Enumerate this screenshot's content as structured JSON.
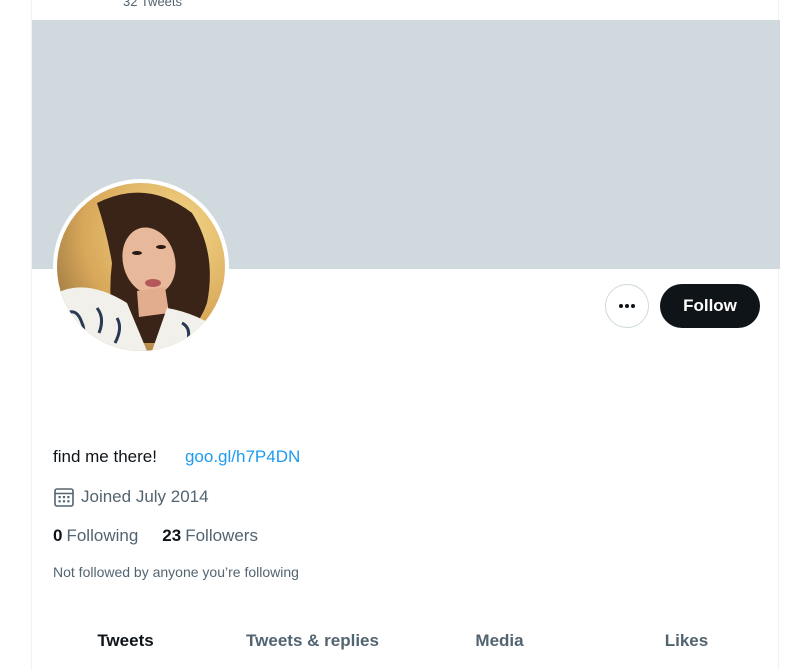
{
  "header": {
    "tweet_count": "32 Tweets"
  },
  "profile": {
    "bio_text": "find me there!",
    "bio_link": "goo.gl/h7P4DN",
    "joined": "Joined July 2014",
    "following_count": "0",
    "following_label": "Following",
    "followers_count": "23",
    "followers_label": "Followers",
    "notice": "Not followed by anyone you’re following"
  },
  "actions": {
    "more_icon": "ellipsis-icon",
    "follow_label": "Follow"
  },
  "tabs": [
    {
      "label": "Tweets",
      "active": true
    },
    {
      "label": "Tweets & replies",
      "active": false
    },
    {
      "label": "Media",
      "active": false
    },
    {
      "label": "Likes",
      "active": false
    }
  ],
  "colors": {
    "banner": "#cfd9de",
    "link": "#1d9bf0",
    "follow_bg": "#0f1419",
    "secondary_text": "#536471"
  }
}
